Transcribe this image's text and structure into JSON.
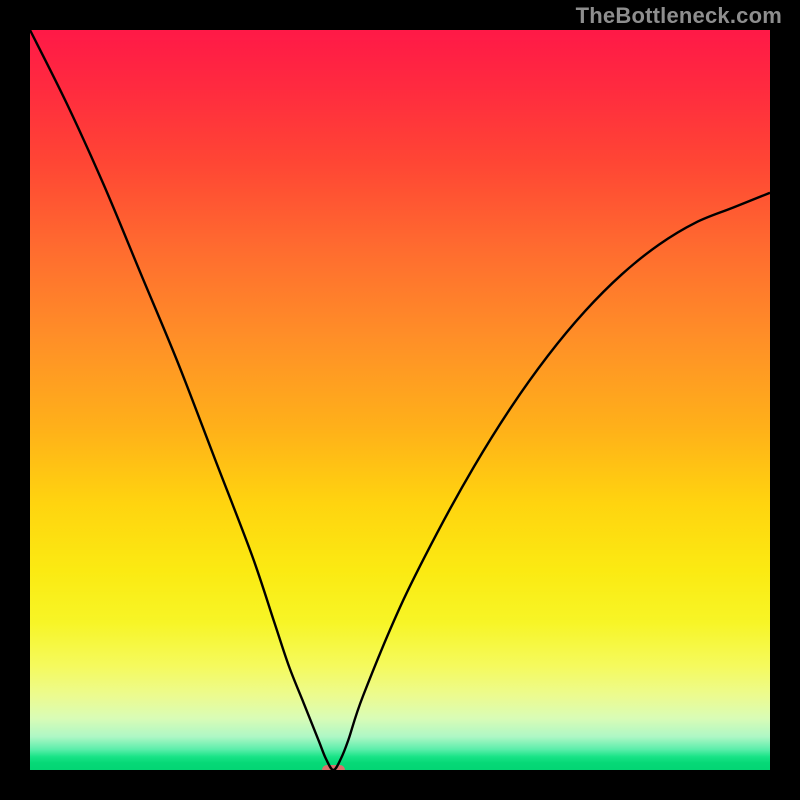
{
  "watermark": "TheBottleneck.com",
  "colors": {
    "frame": "#000000",
    "curve": "#000000",
    "marker": "#d9716c",
    "gradient_stops": [
      "#ff1947",
      "#ff2b3f",
      "#ff4634",
      "#ff6d2f",
      "#ff9027",
      "#ffb119",
      "#ffd40f",
      "#fbea12",
      "#f7f526",
      "#f5fa5e",
      "#ecfb90",
      "#d9fcb6",
      "#aef7c5",
      "#5ceeab",
      "#19e487",
      "#06d977",
      "#03d574"
    ]
  },
  "chart_data": {
    "type": "line",
    "title": "",
    "xlabel": "",
    "ylabel": "",
    "xlim": [
      0,
      100
    ],
    "ylim": [
      0,
      100
    ],
    "grid": false,
    "series": [
      {
        "name": "bottleneck-curve",
        "x": [
          0,
          5,
          10,
          15,
          20,
          25,
          30,
          33,
          35,
          37,
          39,
          40,
          41,
          42,
          43,
          45,
          50,
          55,
          60,
          65,
          70,
          75,
          80,
          85,
          90,
          95,
          100
        ],
        "y": [
          100,
          90,
          79,
          67,
          55,
          42,
          29,
          20,
          14,
          9,
          4,
          1.5,
          0,
          1.5,
          4,
          10,
          22,
          32,
          41,
          49,
          56,
          62,
          67,
          71,
          74,
          76,
          78
        ]
      }
    ],
    "marker": {
      "x": 41,
      "y": 0,
      "width_pct": 3.2,
      "height_pct": 1.4
    },
    "background_meaning": "vertical gradient from red (high bottleneck) at top to green (no bottleneck) at bottom"
  }
}
